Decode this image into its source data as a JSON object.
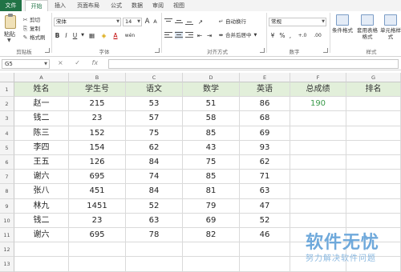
{
  "tabs": [
    "文件",
    "开始",
    "插入",
    "页面布局",
    "公式",
    "数据",
    "审阅",
    "视图"
  ],
  "clipboard": {
    "paste": "粘贴",
    "cut": "剪切",
    "copy": "复制",
    "format_painter": "格式刷",
    "group_label": "剪贴板"
  },
  "font": {
    "name": "宋体",
    "size": "14",
    "group_label": "字体",
    "bold": "B",
    "italic": "I",
    "underline": "U",
    "grow": "A",
    "shrink": "A",
    "font_color": "A",
    "phonetic": "wén"
  },
  "alignment": {
    "wrap_text": "自动换行",
    "merge_center": "合并后居中",
    "group_label": "对齐方式"
  },
  "number": {
    "format": "常规",
    "group_label": "数字",
    "currency": "¥",
    "percent": "%",
    "comma": ",",
    "inc_decimal": "+.0",
    "dec_decimal": ".00"
  },
  "styles": {
    "conditional_format": "条件格式",
    "format_table": "套用表格格式",
    "cell_styles": "单元格样式",
    "group_label": "样式"
  },
  "formula_bar": {
    "name_box": "G5",
    "cancel": "×",
    "enter": "✓",
    "fx": "fx"
  },
  "sheet": {
    "columns": [
      "A",
      "B",
      "C",
      "D",
      "E",
      "F",
      "G"
    ],
    "rows": [
      "1",
      "2",
      "3",
      "4",
      "5",
      "6",
      "7",
      "8",
      "9",
      "10",
      "11",
      "12",
      "13"
    ],
    "header": [
      "姓名",
      "学生号",
      "语文",
      "数学",
      "英语",
      "总成绩",
      "排名"
    ],
    "data": [
      [
        "赵一",
        "215",
        "53",
        "51",
        "86",
        "190",
        ""
      ],
      [
        "钱二",
        "23",
        "57",
        "58",
        "68",
        "",
        ""
      ],
      [
        "陈三",
        "152",
        "75",
        "85",
        "69",
        "",
        ""
      ],
      [
        "李四",
        "154",
        "62",
        "43",
        "93",
        "",
        ""
      ],
      [
        "王五",
        "126",
        "84",
        "75",
        "62",
        "",
        ""
      ],
      [
        "谢六",
        "695",
        "74",
        "85",
        "71",
        "",
        ""
      ],
      [
        "张八",
        "451",
        "84",
        "81",
        "63",
        "",
        ""
      ],
      [
        "林九",
        "1451",
        "52",
        "79",
        "47",
        "",
        ""
      ],
      [
        "钱二",
        "23",
        "63",
        "69",
        "52",
        "",
        ""
      ],
      [
        "谢六",
        "695",
        "78",
        "82",
        "46",
        "",
        ""
      ],
      [
        "",
        "",
        "",
        "",
        "",
        "",
        ""
      ],
      [
        "",
        "",
        "",
        "",
        "",
        "",
        ""
      ]
    ]
  },
  "watermark": {
    "title": "软件无忧",
    "subtitle": "努力解决软件问题"
  },
  "colors": {
    "accent": "#217346",
    "header_fill": "#e2efda",
    "result_text": "#3a9a4a",
    "watermark": "#6fa9db"
  }
}
